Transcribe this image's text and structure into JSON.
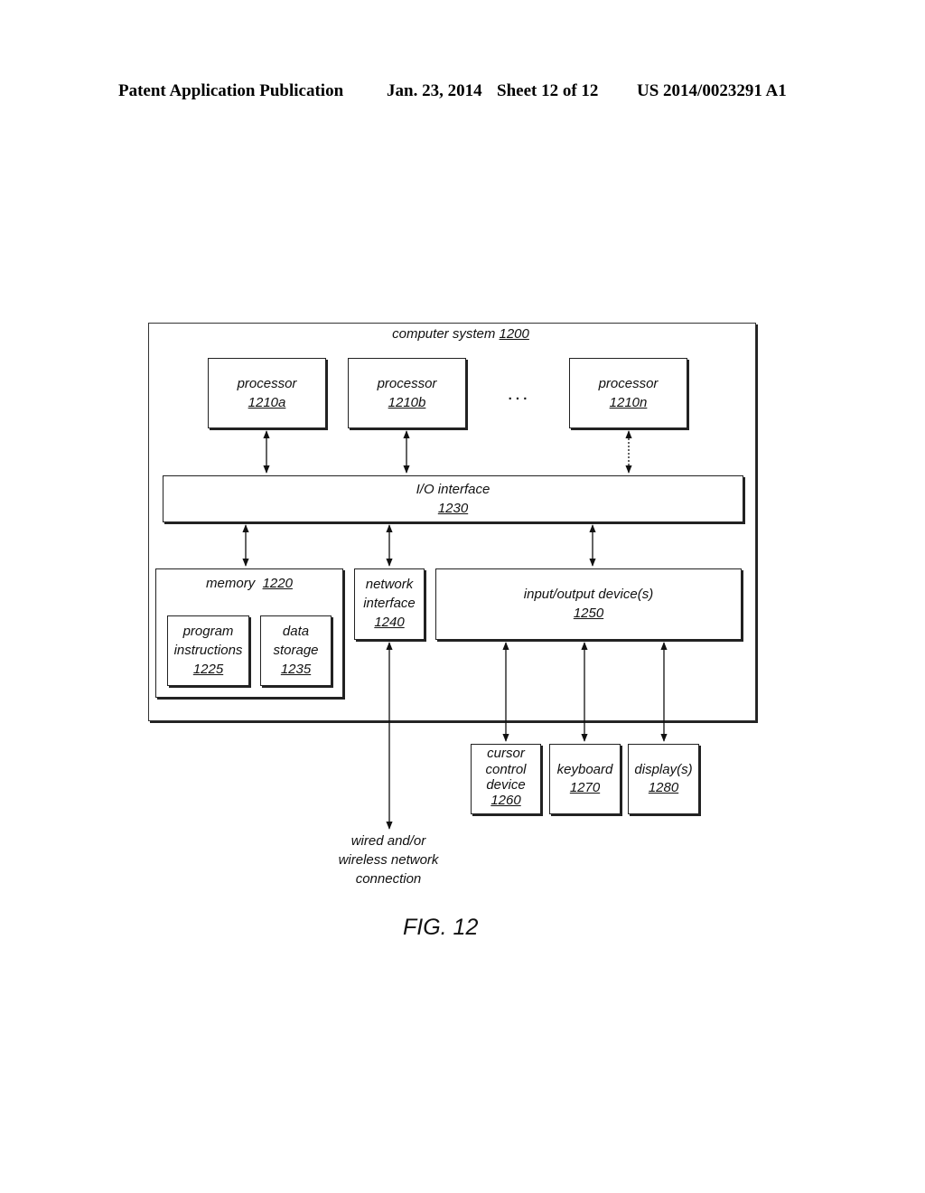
{
  "header": {
    "publication": "Patent Application Publication",
    "date": "Jan. 23, 2014",
    "sheet": "Sheet 12 of 12",
    "number": "US 2014/0023291 A1"
  },
  "diagram": {
    "system": {
      "label": "computer system",
      "ref": "1200"
    },
    "processors": [
      {
        "label": "processor",
        "ref": "1210a"
      },
      {
        "label": "processor",
        "ref": "1210b"
      },
      {
        "label": "processor",
        "ref": "1210n"
      }
    ],
    "ellipsis": ". . .",
    "io_interface": {
      "label": "I/O interface",
      "ref": "1230"
    },
    "memory": {
      "label": "memory",
      "ref": "1220"
    },
    "program_instructions": {
      "line1": "program",
      "line2": "instructions",
      "ref": "1225"
    },
    "data_storage": {
      "line1": "data",
      "line2": "storage",
      "ref": "1235"
    },
    "network_interface": {
      "line1": "network",
      "line2": "interface",
      "ref": "1240"
    },
    "io_devices": {
      "label": "input/output device(s)",
      "ref": "1250"
    },
    "cursor_control": {
      "line1": "cursor",
      "line2": "control",
      "line3": "device",
      "ref": "1260"
    },
    "keyboard": {
      "label": "keyboard",
      "ref": "1270"
    },
    "displays": {
      "label": "display(s)",
      "ref": "1280"
    },
    "network_connection": {
      "line1": "wired and/or",
      "line2": "wireless network",
      "line3": "connection"
    }
  },
  "figure_label": "FIG. 12"
}
